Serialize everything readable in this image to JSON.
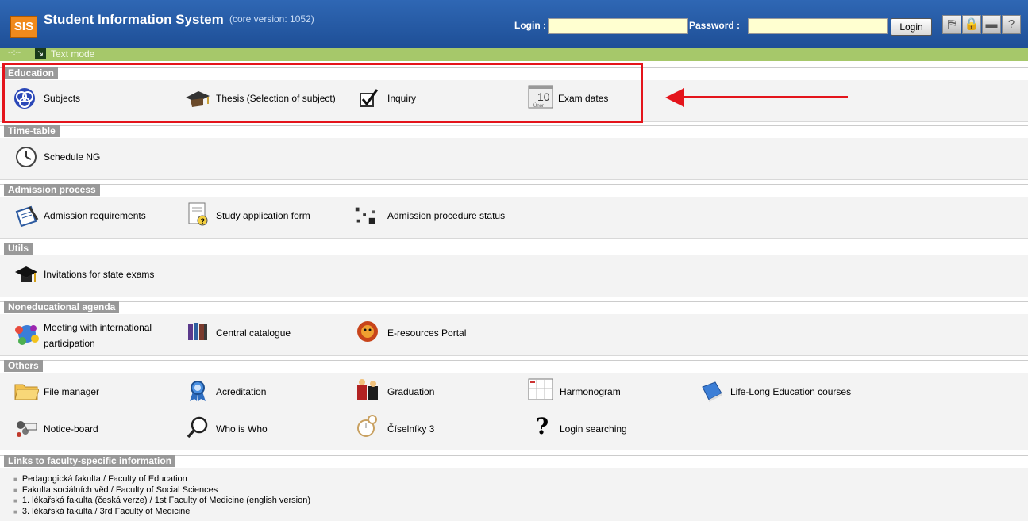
{
  "header": {
    "logo": "SIS",
    "title": "Student Information System",
    "version": "(core version: 1052)",
    "login_label": "Login :",
    "password_label": "Password :",
    "login_button": "Login",
    "toolbar_icons": [
      "accessibility-icon",
      "lock-icon",
      "signpost-icon",
      "help-icon"
    ]
  },
  "modebar": {
    "nav": "--:--",
    "text_mode": "Text mode"
  },
  "sections": {
    "education": {
      "title": "Education",
      "items": [
        "Subjects",
        "Thesis (Selection of subject)",
        "Inquiry",
        "Exam dates"
      ]
    },
    "timetable": {
      "title": "Time-table",
      "items": [
        "Schedule NG"
      ]
    },
    "admission": {
      "title": "Admission process",
      "items": [
        "Admission requirements",
        "Study application form",
        "Admission procedure status"
      ]
    },
    "utils": {
      "title": "Utils",
      "items": [
        "Invitations for state exams"
      ]
    },
    "noneducational": {
      "title": "Noneducational agenda",
      "items": [
        "Meeting with international",
        "participation",
        "Central catalogue",
        "E-resources Portal"
      ]
    },
    "others": {
      "title": "Others",
      "items": [
        "File manager",
        "Acreditation",
        "Graduation",
        "Harmonogram",
        "Life-Long Education courses",
        "Notice-board",
        "Who is Who",
        "Číselníky 3",
        "Login searching"
      ]
    },
    "links": {
      "title": "Links to faculty-specific information",
      "items": [
        "Pedagogická fakulta / Faculty of Education",
        "Fakulta sociálních věd / Faculty of Social Sciences",
        "1. lékařská fakulta (česká verze) / 1st Faculty of Medicine (english version)",
        "3. lékařská fakulta / 3rd Faculty of Medicine"
      ]
    }
  },
  "annotation": {
    "color": "#e4141b"
  },
  "calendar_icon": {
    "day": "10",
    "month": "Únor"
  }
}
